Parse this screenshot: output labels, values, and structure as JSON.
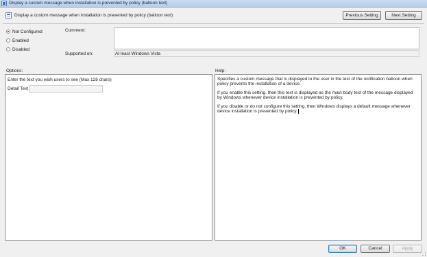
{
  "window": {
    "title": "Display a custom message when installation is prevented by policy (balloon text)"
  },
  "header": {
    "title": "Display a custom message when installation is prevented by policy (balloon text)",
    "prev_button": "Previous Setting",
    "next_button": "Next Setting"
  },
  "state": {
    "options": [
      "Not Configured",
      "Enabled",
      "Disabled"
    ],
    "selected": "Not Configured"
  },
  "comment": {
    "label": "Comment:",
    "value": ""
  },
  "supported": {
    "label": "Supported on:",
    "value": "At least Windows Vista"
  },
  "options_panel": {
    "label": "Options:",
    "prompt": "Enter the text you wish users to see (Max 128 chars)",
    "detail_label": "Detail Text",
    "detail_value": ""
  },
  "help_panel": {
    "label": "Help:",
    "paragraphs": [
      "Specifies a custom message that is displayed to the user in the text of the notification balloon when policy prevents the installation of a device.",
      "If you enable this setting, then this text is displayed as the main body text of the message displayed by Windows whenever device installation is prevented by policy.",
      "If you disable or do not configure this setting, then Windows displays a default message whenever device installation is prevented by policy."
    ]
  },
  "footer": {
    "ok": "OK",
    "cancel": "Cancel",
    "apply": "Apply"
  }
}
